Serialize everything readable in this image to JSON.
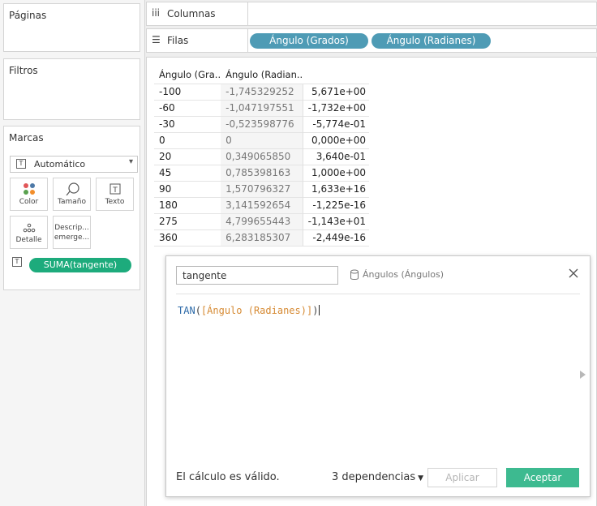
{
  "panels": {
    "pages_title": "Páginas",
    "filters_title": "Filtros",
    "marks_title": "Marcas"
  },
  "marks": {
    "type_value": "Automático",
    "buttons": {
      "color": "Color",
      "size": "Tamaño",
      "text": "Texto",
      "detail": "Detalle",
      "tooltip_line1": "Descrip...",
      "tooltip_line2": "emerge..."
    },
    "field_pill": "SUMA(tangente)"
  },
  "shelves": {
    "columns_label": "Columnas",
    "rows_label": "Filas",
    "row_pills": [
      "Ángulo (Grados)",
      "Ángulo (Radianes)"
    ]
  },
  "table": {
    "headers": [
      "Ángulo (Gra..",
      "Ángulo (Radian.."
    ],
    "rows": [
      [
        "-100",
        "-1,745329252",
        "5,671e+00"
      ],
      [
        "-60",
        "-1,047197551",
        "-1,732e+00"
      ],
      [
        "-30",
        "-0,523598776",
        "-5,774e-01"
      ],
      [
        "0",
        "0",
        "0,000e+00"
      ],
      [
        "20",
        "0,349065850",
        "3,640e-01"
      ],
      [
        "45",
        "0,785398163",
        "1,000e+00"
      ],
      [
        "90",
        "1,570796327",
        "1,633e+16"
      ],
      [
        "180",
        "3,141592654",
        "-1,225e-16"
      ],
      [
        "275",
        "4,799655443",
        "-1,143e+01"
      ],
      [
        "360",
        "6,283185307",
        "-2,449e-16"
      ]
    ]
  },
  "dialog": {
    "calc_name": "tangente",
    "datasource": "Ángulos (Ángulos)",
    "formula": {
      "function": "TAN",
      "open_paren": "(",
      "field": "[Ángulo (Radianes)]",
      "close_paren": ")"
    },
    "status": "El cálculo es válido.",
    "dependencies": "3 dependencias",
    "apply_label": "Aplicar",
    "ok_label": "Aceptar"
  },
  "colors": {
    "green_pill": "#1dab7c",
    "blue_pill": "#4e9bb5",
    "ok_button": "#3dba90"
  }
}
